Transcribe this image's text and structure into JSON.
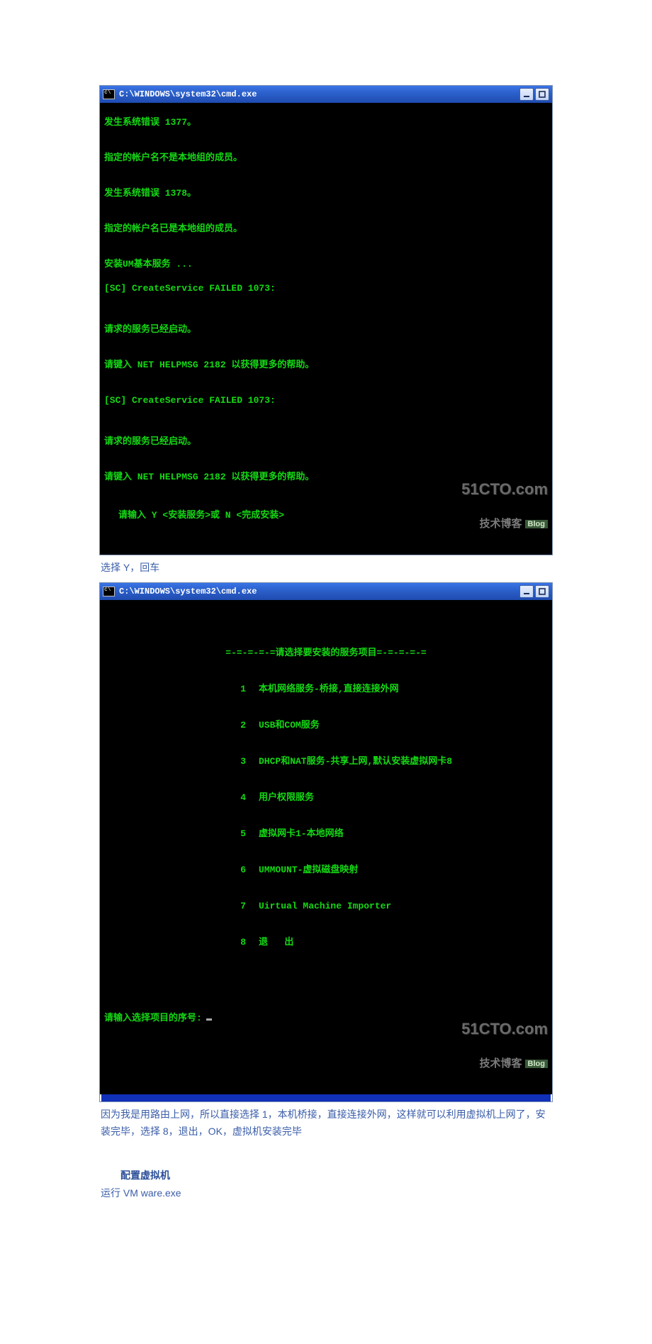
{
  "console1": {
    "title": "C:\\WINDOWS\\system32\\cmd.exe",
    "lines": {
      "l1": "发生系统错误 1377。",
      "l2": "指定的帐户名不是本地组的成员。",
      "l3": "发生系统错误 1378。",
      "l4": "指定的帐户名已是本地组的成员。",
      "l5": "安装UM基本服务 ...",
      "l6": "[SC] CreateService FAILED 1073:",
      "l7": "请求的服务已经启动。",
      "l8": "请键入 NET HELPMSG 2182 以获得更多的帮助。",
      "l9": "[SC] CreateService FAILED 1073:",
      "l10": "请求的服务已经启动。",
      "l11": "请键入 NET HELPMSG 2182 以获得更多的帮助。",
      "l12": "请输入 Y <安装服务>或 N <完成安装>"
    }
  },
  "caption1": "选择 Y，回车",
  "console2": {
    "title": "C:\\WINDOWS\\system32\\cmd.exe",
    "menu_header": "=-=-=-=-=请选择要安装的服务项目=-=-=-=-=",
    "items": [
      {
        "num": "1",
        "label": "本机网络服务-桥接,直接连接外网"
      },
      {
        "num": "2",
        "label": "USB和COM服务"
      },
      {
        "num": "3",
        "label": "DHCP和NAT服务-共享上网,默认安装虚拟网卡8"
      },
      {
        "num": "4",
        "label": "用户权限服务"
      },
      {
        "num": "5",
        "label": "虚拟网卡1-本地网络"
      },
      {
        "num": "6",
        "label": "UMMOUNT-虚拟磁盘映射"
      },
      {
        "num": "7",
        "label": "Uirtual Machine Importer"
      },
      {
        "num": "8",
        "label": "退   出"
      }
    ],
    "prompt": "请输入选择项目的序号:"
  },
  "caption2": "因为我是用路由上网，所以直接选择 1，本机桥接，直接连接外网，这样就可以利用虚拟机上网了，安装完毕，选择 8，退出，OK，虚拟机安装完毕",
  "section_heading": "配置虚拟机",
  "run_text": "运行 VM  ware.exe",
  "watermark": {
    "line1": "51CTO.com",
    "line2": "技术博客",
    "badge": "Blog"
  }
}
